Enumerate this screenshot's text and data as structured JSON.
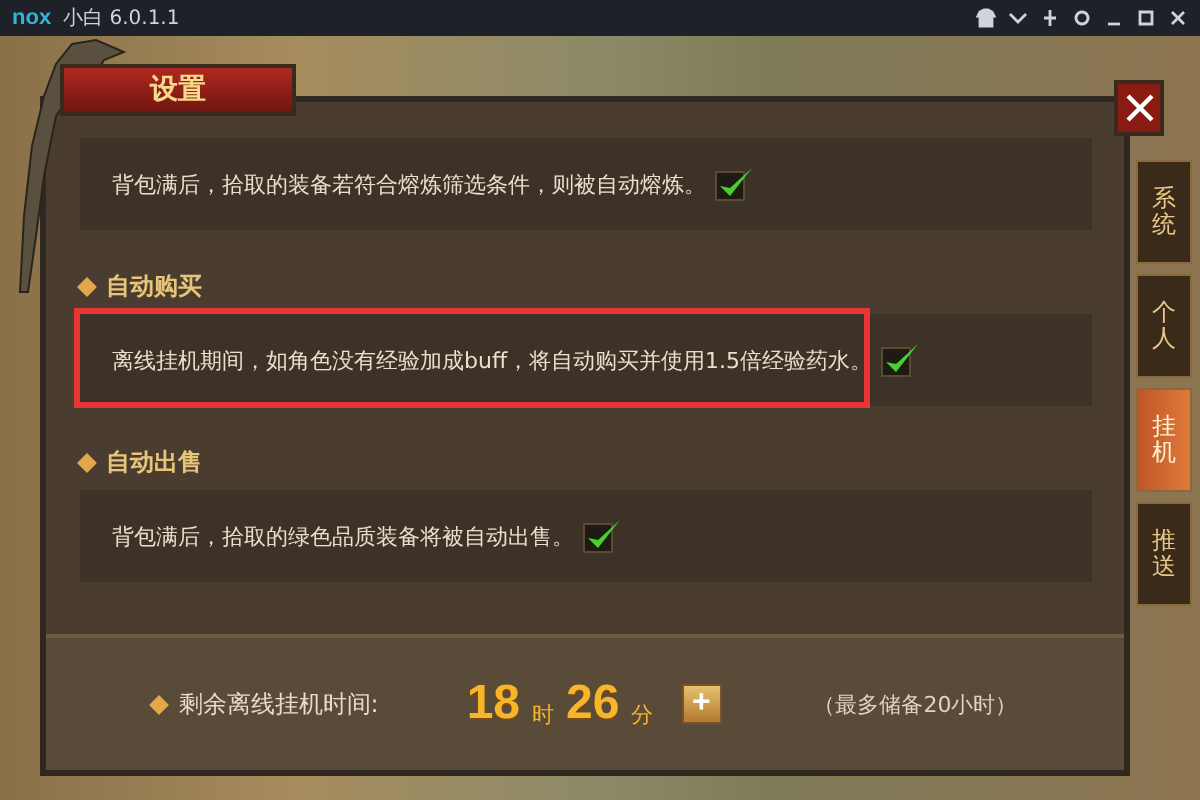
{
  "window": {
    "logo": "nox",
    "title": "小白 6.0.1.1"
  },
  "dialog": {
    "title": "设置"
  },
  "side_tabs": [
    {
      "label": "系统",
      "selected": false
    },
    {
      "label": "个人",
      "selected": false
    },
    {
      "label": "挂机",
      "selected": true
    },
    {
      "label": "推送",
      "selected": false
    }
  ],
  "sections": [
    {
      "options": [
        {
          "text": "背包满后，拾取的装备若符合熔炼筛选条件，则被自动熔炼。",
          "checked": true,
          "highlighted": false
        }
      ]
    },
    {
      "heading": "自动购买",
      "options": [
        {
          "text": "离线挂机期间，如角色没有经验加成buff，将自动购买并使用1.5倍经验药水。",
          "checked": true,
          "highlighted": true
        }
      ]
    },
    {
      "heading": "自动出售",
      "options": [
        {
          "text": "背包满后，拾取的绿色品质装备将被自动出售。",
          "checked": true,
          "highlighted": false
        }
      ]
    }
  ],
  "footer": {
    "label": "剩余离线挂机时间:",
    "hours": "18",
    "hours_unit": "时",
    "minutes": "26",
    "minutes_unit": "分",
    "plus": "+",
    "note": "（最多储备20小时）"
  }
}
